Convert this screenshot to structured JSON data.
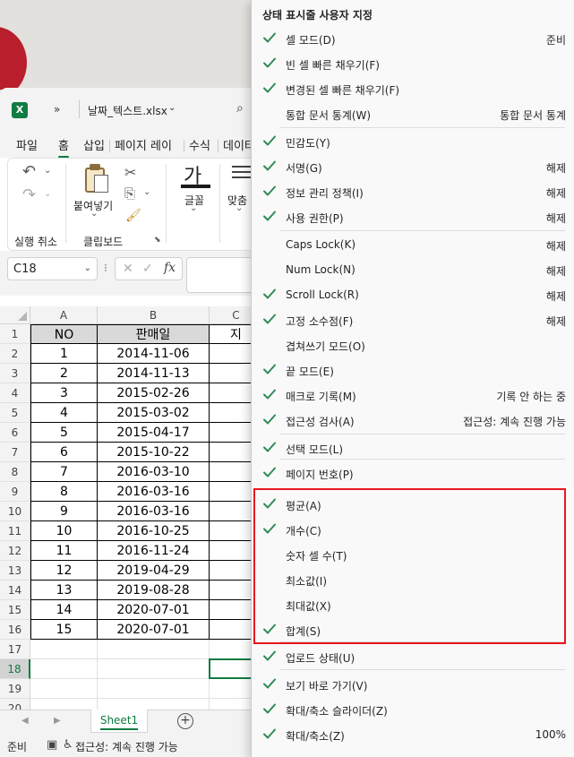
{
  "titlebar": {
    "app_icon": "excel-icon",
    "more_glyph": "»",
    "filename": "날짜_텍스트.xlsx"
  },
  "tabs": [
    "파일",
    "홈",
    "삽입",
    "페이지 레이",
    "수식",
    "데이터"
  ],
  "ribbon": {
    "undo_label": "실행 취소",
    "clipboard_label": "클립보드",
    "paste_label": "붙여넣기",
    "font_glyph": "가",
    "font_label": "글꼴",
    "align_label": "맞춤"
  },
  "formula_bar": {
    "name_box": "C18",
    "fx": "fx"
  },
  "grid": {
    "columns": [
      "A",
      "B",
      "C"
    ],
    "rows": [
      "1",
      "2",
      "3",
      "4",
      "5",
      "6",
      "7",
      "8",
      "9",
      "10",
      "11",
      "12",
      "13",
      "14",
      "15",
      "16",
      "17",
      "18",
      "19",
      "20"
    ],
    "header": {
      "no": "NO",
      "date": "판매일",
      "c_partial": "지"
    },
    "data": [
      [
        "1",
        "2014-11-06"
      ],
      [
        "2",
        "2014-11-13"
      ],
      [
        "3",
        "2015-02-26"
      ],
      [
        "4",
        "2015-03-02"
      ],
      [
        "5",
        "2015-04-17"
      ],
      [
        "6",
        "2015-10-22"
      ],
      [
        "7",
        "2016-03-10"
      ],
      [
        "8",
        "2016-03-16"
      ],
      [
        "9",
        "2016-03-16"
      ],
      [
        "10",
        "2016-10-25"
      ],
      [
        "11",
        "2016-11-24"
      ],
      [
        "12",
        "2019-04-29"
      ],
      [
        "13",
        "2019-08-28"
      ],
      [
        "14",
        "2020-07-01"
      ],
      [
        "15",
        "2020-07-01"
      ]
    ],
    "selected_row": "18"
  },
  "sheet_tabs": {
    "active": "Sheet1",
    "add": "+"
  },
  "status_bar": {
    "ready": "준비",
    "accessibility": "접근성: 계속 진행 가능"
  },
  "menu": {
    "title": "상태 표시줄 사용자 지정",
    "items": [
      {
        "label": "셀 모드(D)",
        "value": "준비",
        "checked": true
      },
      {
        "label": "빈 셀 빠른 채우기(F)",
        "value": "",
        "checked": true
      },
      {
        "label": "변경된 셀 빠른 채우기(F)",
        "value": "",
        "checked": true
      },
      {
        "label": "통합 문서 통계(W)",
        "value": "통합 문서 통계",
        "checked": false
      },
      {
        "label": "민감도(Y)",
        "value": "",
        "checked": true
      },
      {
        "label": "서명(G)",
        "value": "해제",
        "checked": true
      },
      {
        "label": "정보 관리 정책(I)",
        "value": "해제",
        "checked": true
      },
      {
        "label": "사용 권한(P)",
        "value": "해제",
        "checked": true
      },
      {
        "label": "Caps Lock(K)",
        "value": "해제",
        "checked": false
      },
      {
        "label": "Num Lock(N)",
        "value": "해제",
        "checked": false
      },
      {
        "label": "Scroll Lock(R)",
        "value": "해제",
        "checked": true
      },
      {
        "label": "고정 소수점(F)",
        "value": "해제",
        "checked": true
      },
      {
        "label": "겹쳐쓰기 모드(O)",
        "value": "",
        "checked": false
      },
      {
        "label": "끝 모드(E)",
        "value": "",
        "checked": true
      },
      {
        "label": "매크로 기록(M)",
        "value": "기록 안 하는 중",
        "checked": true
      },
      {
        "label": "접근성 검사(A)",
        "value": "접근성: 계속 진행 가능",
        "checked": true
      },
      {
        "label": "선택 모드(L)",
        "value": "",
        "checked": true
      },
      {
        "label": "페이지 번호(P)",
        "value": "",
        "checked": true
      },
      {
        "label": "평균(A)",
        "value": "",
        "checked": true
      },
      {
        "label": "개수(C)",
        "value": "",
        "checked": true
      },
      {
        "label": "숫자 셀 수(T)",
        "value": "",
        "checked": false
      },
      {
        "label": "최소값(I)",
        "value": "",
        "checked": false
      },
      {
        "label": "최대값(X)",
        "value": "",
        "checked": false
      },
      {
        "label": "합계(S)",
        "value": "",
        "checked": true
      },
      {
        "label": "업로드 상태(U)",
        "value": "",
        "checked": true
      },
      {
        "label": "보기 바로 가기(V)",
        "value": "",
        "checked": true
      },
      {
        "label": "확대/축소 슬라이더(Z)",
        "value": "",
        "checked": true
      },
      {
        "label": "확대/축소(Z)",
        "value": "100%",
        "checked": true
      }
    ]
  },
  "colors": {
    "excel_green": "#107c41",
    "check_green": "#2e8b57",
    "highlight_red": "#e8161e"
  }
}
